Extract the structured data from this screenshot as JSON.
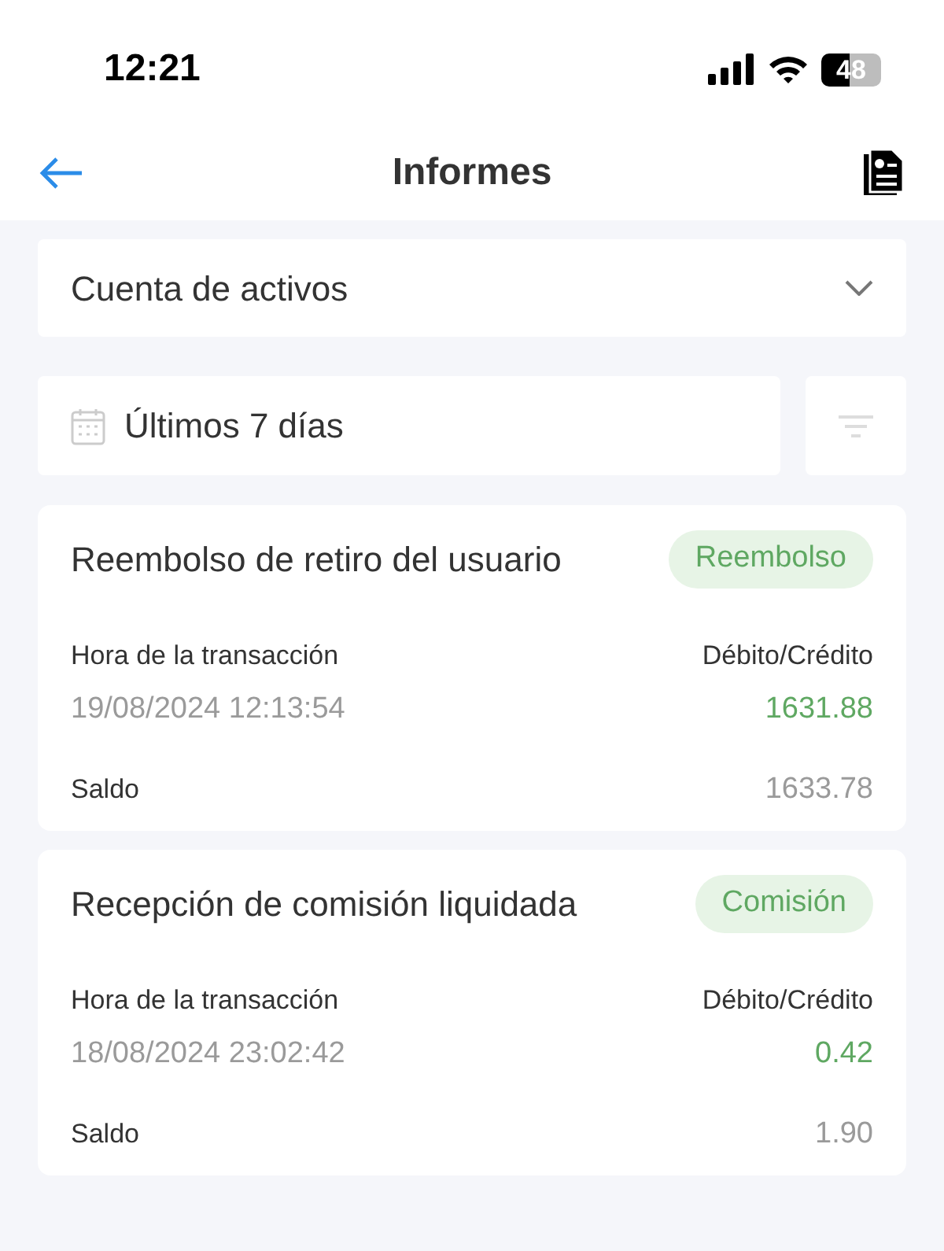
{
  "status_bar": {
    "time": "12:21",
    "battery": "48"
  },
  "header": {
    "title": "Informes"
  },
  "account_select": {
    "value": "Cuenta de activos"
  },
  "date_filter": {
    "value": "Últimos 7 días"
  },
  "transactions": [
    {
      "title": "Reembolso de retiro del usuario",
      "tag": "Reembolso",
      "time_label": "Hora de la transacción",
      "time": "19/08/2024 12:13:54",
      "amount_label": "Débito/Crédito",
      "amount": "1631.88",
      "balance_label": "Saldo",
      "balance": "1633.78"
    },
    {
      "title": "Recepción de comisión liquidada",
      "tag": "Comisión",
      "time_label": "Hora de la transacción",
      "time": "18/08/2024 23:02:42",
      "amount_label": "Débito/Crédito",
      "amount": "0.42",
      "balance_label": "Saldo",
      "balance": "1.90"
    }
  ]
}
